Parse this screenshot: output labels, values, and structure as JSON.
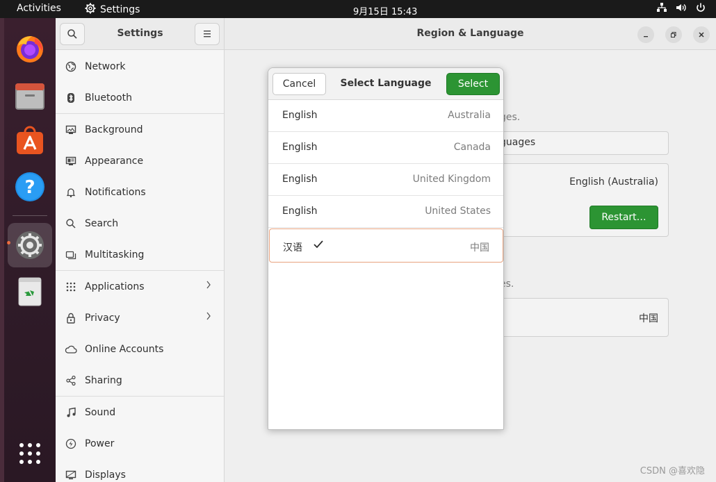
{
  "topbar": {
    "activities": "Activities",
    "app_name": "Settings",
    "clock": "9月15日  15:43"
  },
  "dock": {
    "items": [
      "firefox-icon",
      "files-icon",
      "app-center-icon",
      "help-icon",
      "settings-icon",
      "trash-icon",
      "show-apps-icon"
    ]
  },
  "window": {
    "sidebar_title": "Settings",
    "title": "Region & Language"
  },
  "sidebar": {
    "items": [
      {
        "label": "Network",
        "icon": "network-icon"
      },
      {
        "label": "Bluetooth",
        "icon": "bluetooth-icon"
      },
      {
        "label": "Background",
        "icon": "background-icon"
      },
      {
        "label": "Appearance",
        "icon": "appearance-icon"
      },
      {
        "label": "Notifications",
        "icon": "bell-icon"
      },
      {
        "label": "Search",
        "icon": "search-icon"
      },
      {
        "label": "Multitasking",
        "icon": "multitasking-icon"
      },
      {
        "label": "Applications",
        "icon": "grid-icon"
      },
      {
        "label": "Privacy",
        "icon": "lock-icon"
      },
      {
        "label": "Online Accounts",
        "icon": "cloud-icon"
      },
      {
        "label": "Sharing",
        "icon": "share-icon"
      },
      {
        "label": "Sound",
        "icon": "music-note-icon"
      },
      {
        "label": "Power",
        "icon": "power-icon"
      },
      {
        "label": "Displays",
        "icon": "display-icon"
      }
    ]
  },
  "background": {
    "ges_fragment": "ges.",
    "languages_fragment": "guages",
    "current_language": "English (Australia)",
    "restart_label": "Restart…",
    "es_fragment": "es.",
    "format_value": "中国"
  },
  "dialog": {
    "cancel": "Cancel",
    "title": "Select Language",
    "select": "Select",
    "languages": [
      {
        "name": "English",
        "region": "Australia"
      },
      {
        "name": "English",
        "region": "Canada"
      },
      {
        "name": "English",
        "region": "United Kingdom"
      },
      {
        "name": "English",
        "region": "United States"
      },
      {
        "name": "汉语",
        "region": "中国"
      }
    ]
  },
  "watermark": "CSDN @喜欢隐",
  "colors": {
    "accent_green": "#2c9433",
    "selection_border": "#e8a27e",
    "ubuntu_orange": "#e95420"
  }
}
